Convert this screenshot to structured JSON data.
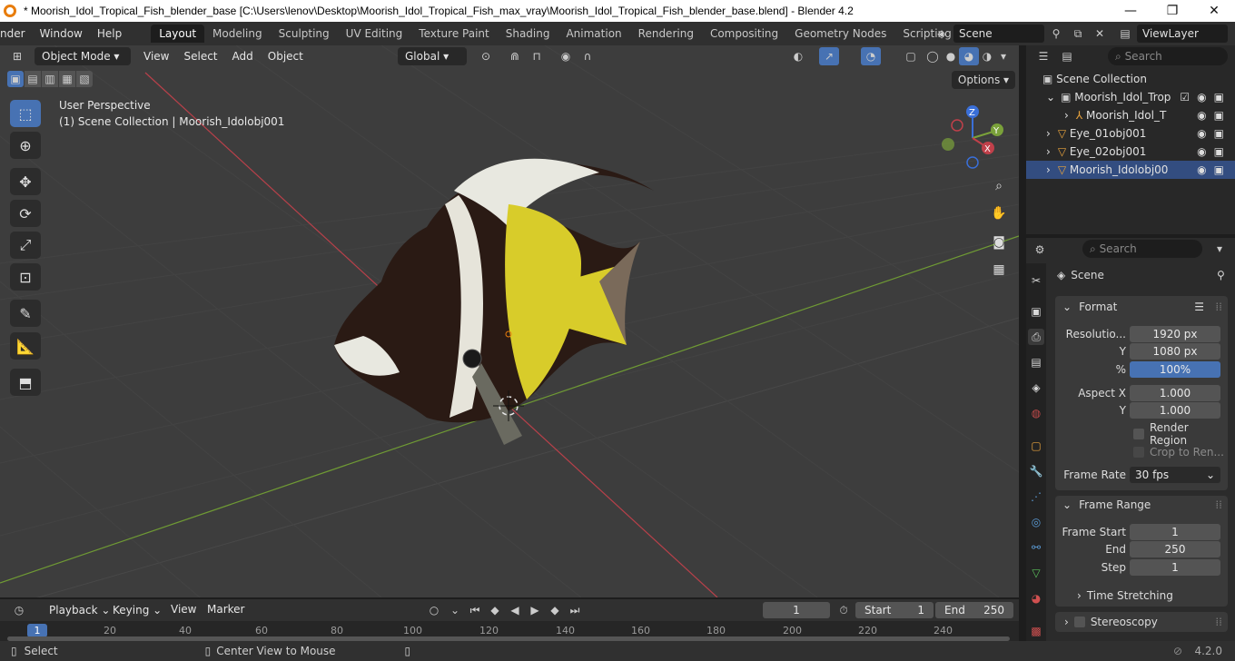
{
  "window": {
    "title": "* Moorish_Idol_Tropical_Fish_blender_base [C:\\Users\\lenov\\Desktop\\Moorish_Idol_Tropical_Fish_max_vray\\Moorish_Idol_Tropical_Fish_blender_base.blend] - Blender 4.2",
    "minimize": "—",
    "maximize": "❐",
    "close": "✕"
  },
  "menubar": {
    "items": [
      "nder",
      "Window",
      "Help"
    ]
  },
  "workspaces": [
    "Layout",
    "Modeling",
    "Sculpting",
    "UV Editing",
    "Texture Paint",
    "Shading",
    "Animation",
    "Rendering",
    "Compositing",
    "Geometry Nodes",
    "Scripting"
  ],
  "active_workspace": "Layout",
  "scene_name": "Scene",
  "view_layer": "ViewLayer",
  "viewport": {
    "mode": "Object Mode",
    "menus": [
      "View",
      "Select",
      "Add",
      "Object"
    ],
    "transform_orientation": "Global",
    "options_label": "Options",
    "overlay_line1": "User Perspective",
    "overlay_line2": "(1) Scene Collection | Moorish_Idolobj001",
    "gizmo": {
      "x": "X",
      "y": "Y",
      "z": "Z"
    }
  },
  "outliner": {
    "search_placeholder": "Search",
    "root": "Scene Collection",
    "rows": [
      {
        "label": "Moorish_Idol_Trop"
      },
      {
        "label": "Moorish_Idol_T"
      },
      {
        "label": "Eye_01obj001"
      },
      {
        "label": "Eye_02obj001"
      },
      {
        "label": "Moorish_Idolobj00"
      }
    ]
  },
  "properties": {
    "search_placeholder": "Search",
    "context": "Scene",
    "format_panel": {
      "title": "Format",
      "resolution_label": "Resolutio...",
      "resolution_x": "1920 px",
      "y_label": "Y",
      "resolution_y": "1080 px",
      "pct_label": "%",
      "resolution_pct": "100%",
      "aspect_x_label": "Aspect X",
      "aspect_x": "1.000",
      "aspect_y_label": "Y",
      "aspect_y": "1.000",
      "render_region": "Render Region",
      "crop": "Crop to Ren...",
      "frame_rate_label": "Frame Rate",
      "frame_rate": "30 fps"
    },
    "frame_range_panel": {
      "title": "Frame Range",
      "start_label": "Frame Start",
      "start": "1",
      "end_label": "End",
      "end": "250",
      "step_label": "Step",
      "step": "1",
      "time_stretching": "Time Stretching"
    },
    "stereoscopy": "Stereoscopy"
  },
  "timeline": {
    "menus": [
      "Playback",
      "Keying",
      "View",
      "Marker"
    ],
    "current_frame": "1",
    "start_label": "Start",
    "start": "1",
    "end_label": "End",
    "end": "250",
    "ruler": [
      "1",
      "20",
      "40",
      "60",
      "80",
      "100",
      "120",
      "140",
      "160",
      "180",
      "200",
      "220",
      "240"
    ]
  },
  "statusbar": {
    "select": "Select",
    "center_view": "Center View to Mouse",
    "version": "4.2.0"
  },
  "colors": {
    "accent": "#4772b3",
    "x_axis": "#c0404a",
    "y_axis": "#7aa13a",
    "z_axis": "#3a6fd8"
  }
}
